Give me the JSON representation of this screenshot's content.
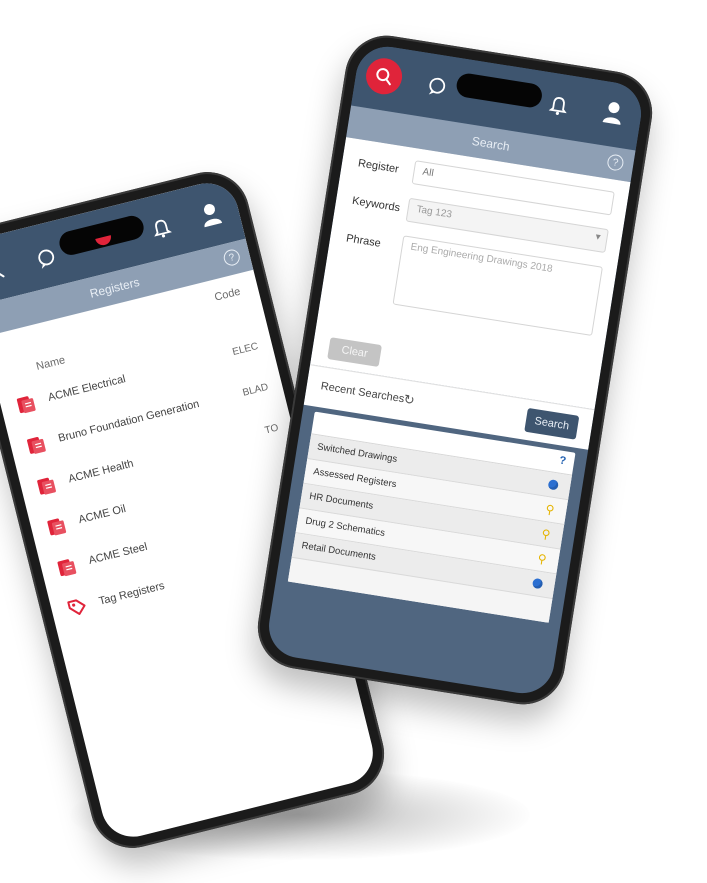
{
  "colors": {
    "nav_bg": "#3e556f",
    "title_bg": "#8e9fb4",
    "accent_red": "#e0243a",
    "body_dark": "#506680"
  },
  "phone_registers": {
    "title": "Registers",
    "columns": {
      "code": "Code",
      "name": "Name"
    },
    "items": [
      {
        "name": "ACME Electrical",
        "code": "ELEC",
        "icon": "register-icon"
      },
      {
        "name": "Bruno Foundation Generation",
        "code": "BLAD",
        "icon": "register-icon"
      },
      {
        "name": "ACME Health",
        "code": "TO",
        "icon": "register-icon"
      },
      {
        "name": "ACME Oil",
        "code": "",
        "icon": "register-icon"
      },
      {
        "name": "ACME Steel",
        "code": "",
        "icon": "register-icon"
      },
      {
        "name": "Tag Registers",
        "code": "",
        "icon": "tag-icon"
      }
    ]
  },
  "phone_search": {
    "title": "Search",
    "fields": {
      "register_label": "Register",
      "register_value": "All",
      "keywords_label": "Keywords",
      "keywords_placeholder": "Tag 123",
      "phrase_label": "Phrase",
      "phrase_placeholder": "Eng Engineering Drawings 2018"
    },
    "clear_label": "Clear",
    "recent_label": "Recent Searches",
    "search_label": "Search",
    "results": [
      {
        "label": "Switched Drawings",
        "marker": "blue"
      },
      {
        "label": "Assessed Registers",
        "marker": "key"
      },
      {
        "label": "HR Documents",
        "marker": "key"
      },
      {
        "label": "Drug 2 Schematics",
        "marker": "key"
      },
      {
        "label": "Retail Documents",
        "marker": "blue"
      }
    ]
  }
}
